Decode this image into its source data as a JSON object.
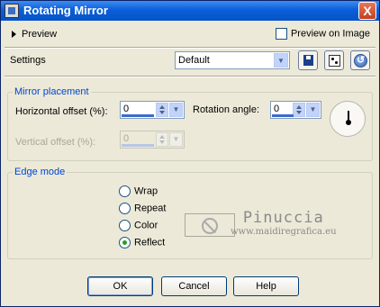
{
  "window": {
    "title": "Rotating Mirror",
    "close_label": "X"
  },
  "preview": {
    "toggle_label": "Preview",
    "preview_on_image_label": "Preview on Image",
    "preview_on_image_checked": false
  },
  "settings": {
    "label": "Settings",
    "selected": "Default"
  },
  "mirror_placement": {
    "legend": "Mirror placement",
    "horizontal_offset_label": "Horizontal offset (%):",
    "horizontal_offset_value": "0",
    "vertical_offset_label": "Vertical offset (%):",
    "vertical_offset_value": "0",
    "vertical_offset_enabled": false,
    "rotation_angle_label": "Rotation angle:",
    "rotation_angle_value": "0"
  },
  "edge_mode": {
    "legend": "Edge mode",
    "options": [
      {
        "label": "Wrap",
        "checked": false
      },
      {
        "label": "Repeat",
        "checked": false
      },
      {
        "label": "Color",
        "checked": false
      },
      {
        "label": "Reflect",
        "checked": true
      }
    ]
  },
  "watermark": {
    "name": "Pinuccia",
    "site": "www.maidiregrafica.eu"
  },
  "buttons": {
    "ok": "OK",
    "cancel": "Cancel",
    "help": "Help"
  },
  "colors": {
    "titlebar": "#0553c7",
    "accent": "#0046d5",
    "dialog_bg": "#ece9d8"
  },
  "icons": {
    "save": "save-icon",
    "randomize": "dice-icon",
    "reset": "reset-icon",
    "no_color": "no-symbol-icon",
    "dial": "rotation-dial-icon"
  }
}
